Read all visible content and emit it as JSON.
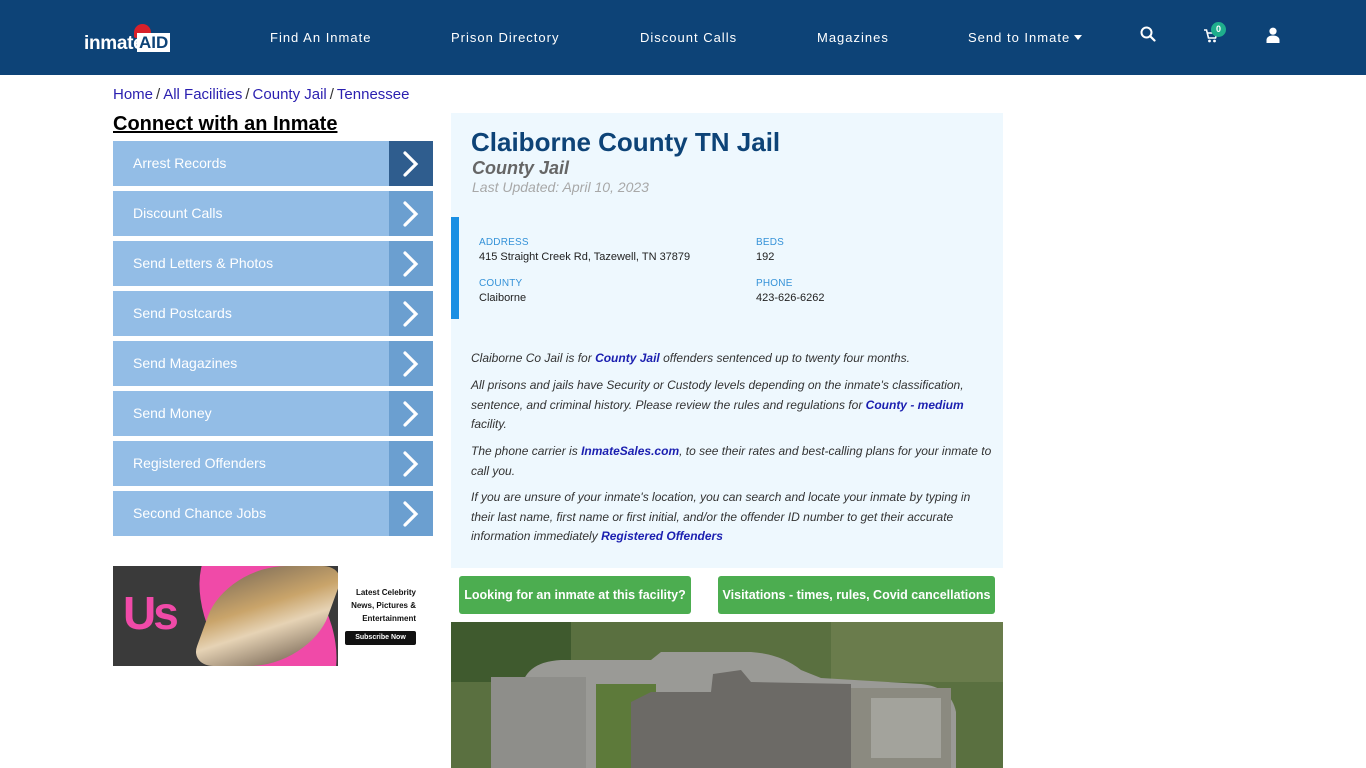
{
  "header": {
    "logo": {
      "text": "inmate",
      "accent": "AID"
    },
    "nav": [
      {
        "label": "Find An Inmate"
      },
      {
        "label": "Prison Directory"
      },
      {
        "label": "Discount Calls"
      },
      {
        "label": "Magazines"
      },
      {
        "label": "Send to Inmate",
        "has_dropdown": true
      }
    ],
    "icons": [
      "search-icon",
      "cart-icon",
      "user-icon"
    ],
    "cart_count": "0"
  },
  "breadcrumb": [
    {
      "label": "Home"
    },
    {
      "label": "All Facilities"
    },
    {
      "label": "County Jail"
    },
    {
      "label": "Tennessee"
    }
  ],
  "sidebar": {
    "title": "Connect with an Inmate",
    "items": [
      {
        "label": "Arrest Records",
        "active": true
      },
      {
        "label": "Discount Calls"
      },
      {
        "label": "Send Letters & Photos"
      },
      {
        "label": "Send Postcards"
      },
      {
        "label": "Send Magazines"
      },
      {
        "label": "Send Money"
      },
      {
        "label": "Registered Offenders"
      },
      {
        "label": "Second Chance Jobs"
      }
    ],
    "ad": {
      "brand": "Us",
      "tagline": "Latest Celebrity\nNews, Pictures &\nEntertainment",
      "cta": "Subscribe Now"
    }
  },
  "facility": {
    "name": "Claiborne County TN Jail",
    "type": "County Jail",
    "last_updated": "Last Updated: April 10, 2023",
    "info": {
      "address_label": "ADDRESS",
      "address": "415 Straight Creek Rd, Tazewell, TN 37879",
      "beds_label": "BEDS",
      "beds": "192",
      "county_label": "COUNTY",
      "county": "Claiborne",
      "phone_label": "PHONE",
      "phone": "423-626-6262"
    },
    "paragraphs": {
      "p1_pre": "Claiborne Co Jail is for ",
      "p1_link": "County Jail",
      "p1_post": " offenders sentenced up to twenty four months.",
      "p2_pre": "All prisons and jails have Security or Custody levels depending on the inmate's classification, sentence, and criminal history. Please review the rules and regulations for ",
      "p2_link": "County - medium",
      "p2_post": " facility.",
      "p3_pre": "The phone carrier is ",
      "p3_link": "InmateSales.com",
      "p3_post": ", to see their rates and best-calling plans for your inmate to call you.",
      "p4_pre": "If you are unsure of your inmate's location, you can search and locate your inmate by typing in their last name, first name or first initial, and/or the offender ID number to get their accurate information immediately ",
      "p4_link": "Registered Offenders"
    },
    "buttons": {
      "find_inmate": "Looking for an inmate at this facility?",
      "visitation": "Visitations - times, rules, Covid cancellations"
    }
  },
  "colors": {
    "header_bg": "#0d4377",
    "sidebar_item": "#93bde6",
    "sidebar_chevron": "#6b9fd0",
    "sidebar_chevron_active": "#2f5d8e",
    "card_bg": "#eef8fe",
    "accent_blue": "#1a8fe3",
    "button_green": "#4cad50",
    "badge_green": "#1fae8c"
  }
}
